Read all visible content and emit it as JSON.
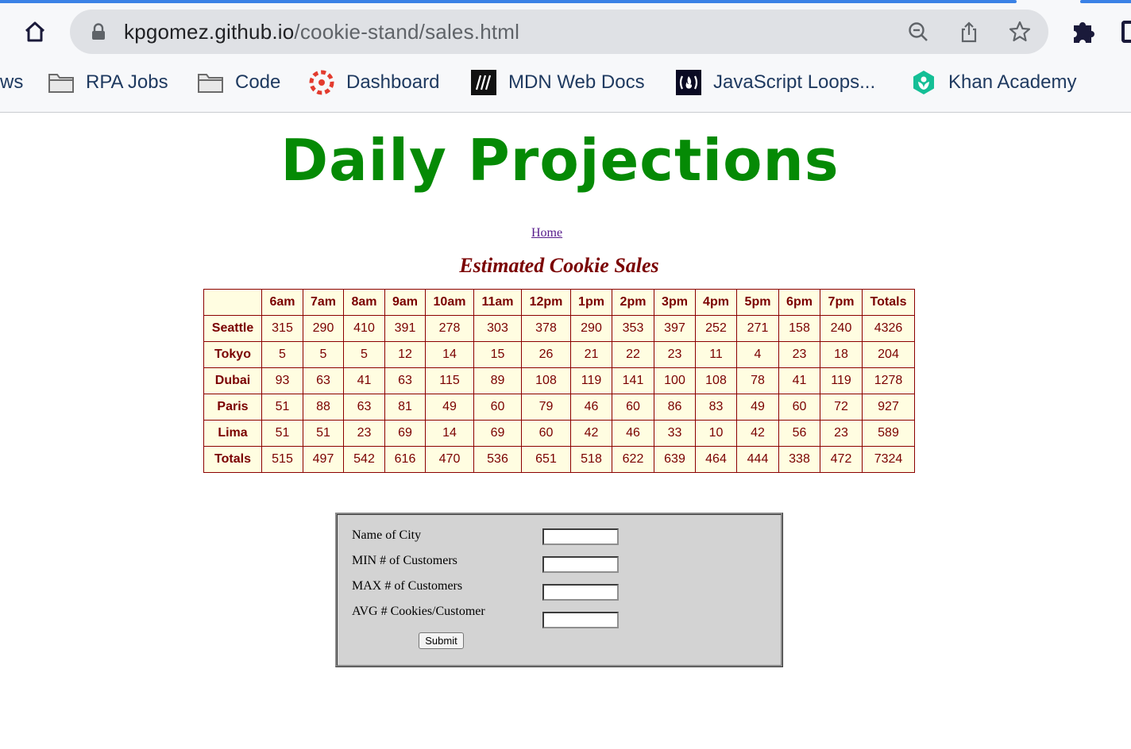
{
  "browser": {
    "url_host": "kpgomez.github.io",
    "url_path": "/cookie-stand/sales.html",
    "bookmarks": [
      {
        "label": "ws",
        "icon": "none"
      },
      {
        "label": "RPA Jobs",
        "icon": "folder-icon"
      },
      {
        "label": "Code",
        "icon": "folder-icon"
      },
      {
        "label": "Dashboard",
        "icon": "dashboard-logo-icon"
      },
      {
        "label": "MDN Web Docs",
        "icon": "mdn-logo-icon"
      },
      {
        "label": "JavaScript Loops...",
        "icon": "freecodecamp-logo-icon"
      },
      {
        "label": "Khan Academy",
        "icon": "khan-academy-logo-icon"
      }
    ]
  },
  "page": {
    "title": "Daily Projections",
    "home_link": "Home",
    "table_caption": "Estimated Cookie Sales"
  },
  "table": {
    "headers": [
      "",
      "6am",
      "7am",
      "8am",
      "9am",
      "10am",
      "11am",
      "12pm",
      "1pm",
      "2pm",
      "3pm",
      "4pm",
      "5pm",
      "6pm",
      "7pm",
      "Totals"
    ],
    "rows": [
      {
        "city": "Seattle",
        "values": [
          "315",
          "290",
          "410",
          "391",
          "278",
          "303",
          "378",
          "290",
          "353",
          "397",
          "252",
          "271",
          "158",
          "240",
          "4326"
        ]
      },
      {
        "city": "Tokyo",
        "values": [
          "5",
          "5",
          "5",
          "12",
          "14",
          "15",
          "26",
          "21",
          "22",
          "23",
          "11",
          "4",
          "23",
          "18",
          "204"
        ]
      },
      {
        "city": "Dubai",
        "values": [
          "93",
          "63",
          "41",
          "63",
          "115",
          "89",
          "108",
          "119",
          "141",
          "100",
          "108",
          "78",
          "41",
          "119",
          "1278"
        ]
      },
      {
        "city": "Paris",
        "values": [
          "51",
          "88",
          "63",
          "81",
          "49",
          "60",
          "79",
          "46",
          "60",
          "86",
          "83",
          "49",
          "60",
          "72",
          "927"
        ]
      },
      {
        "city": "Lima",
        "values": [
          "51",
          "51",
          "23",
          "69",
          "14",
          "69",
          "60",
          "42",
          "46",
          "33",
          "10",
          "42",
          "56",
          "23",
          "589"
        ]
      }
    ],
    "totals": {
      "label": "Totals",
      "values": [
        "515",
        "497",
        "542",
        "616",
        "470",
        "536",
        "651",
        "518",
        "622",
        "639",
        "464",
        "444",
        "338",
        "472",
        "7324"
      ]
    }
  },
  "form": {
    "fields": [
      {
        "label": "Name of City",
        "value": ""
      },
      {
        "label": "MIN # of Customers",
        "value": ""
      },
      {
        "label": "MAX # of Customers",
        "value": ""
      },
      {
        "label": "AVG # Cookies/Customer",
        "value": ""
      }
    ],
    "submit_label": "Submit"
  },
  "colors": {
    "title": "#058a05",
    "table_text": "#7a0000",
    "table_bg": "#fffde1",
    "form_bg": "#d3d3d3"
  }
}
